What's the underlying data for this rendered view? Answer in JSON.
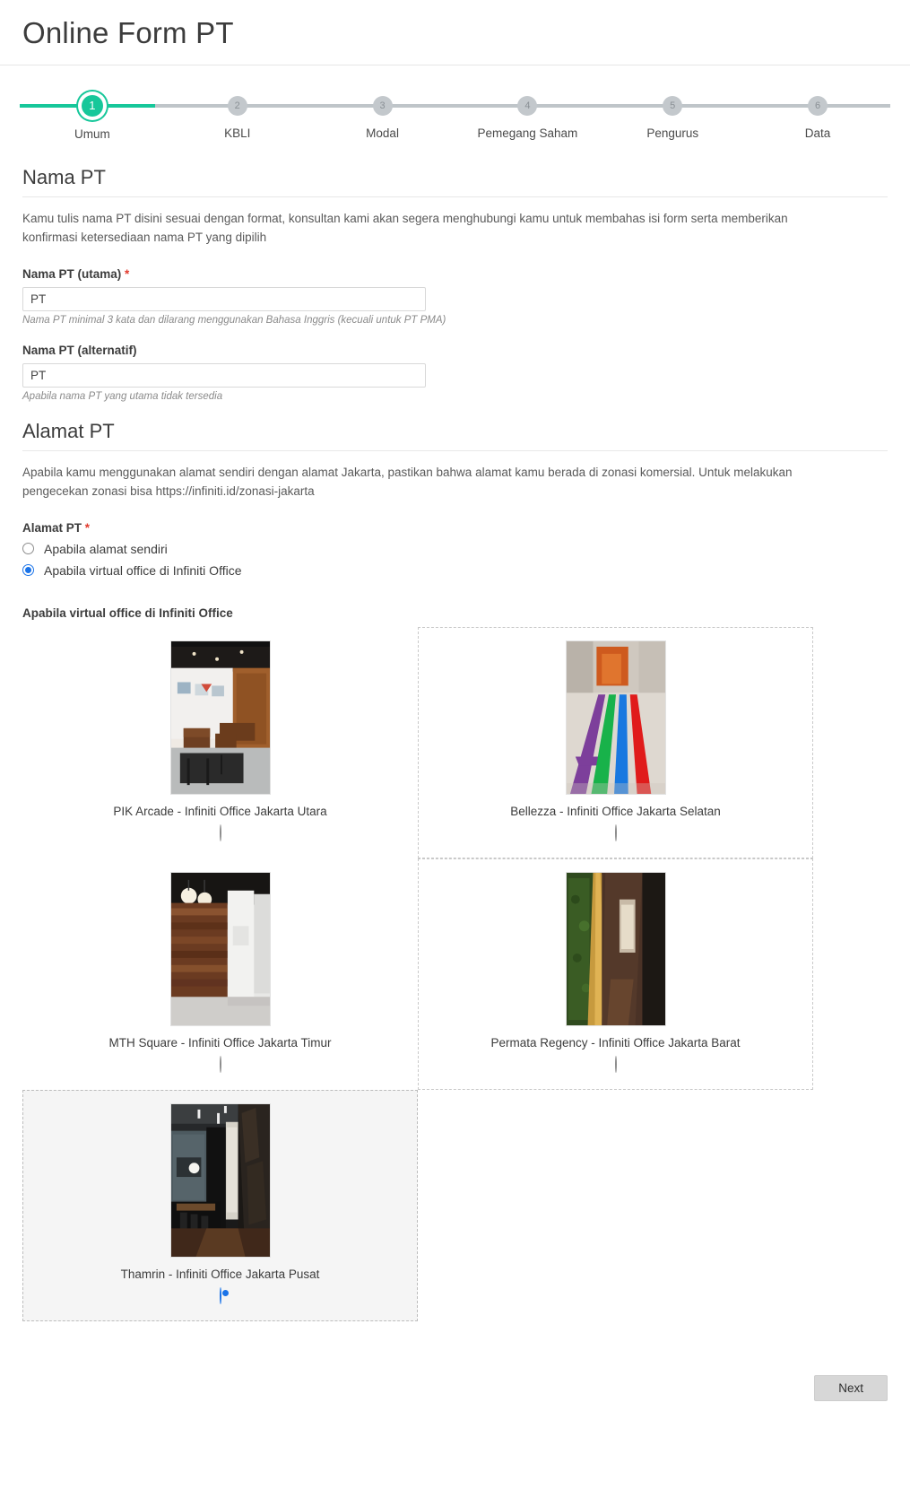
{
  "header": {
    "title": "Online Form PT"
  },
  "stepper": {
    "active_index": 0,
    "active_color": "#16c79a",
    "inactive_color": "#c3c8cc",
    "steps": [
      {
        "number": "1",
        "label": "Umum"
      },
      {
        "number": "2",
        "label": "KBLI"
      },
      {
        "number": "3",
        "label": "Modal"
      },
      {
        "number": "4",
        "label": "Pemegang Saham"
      },
      {
        "number": "5",
        "label": "Pengurus"
      },
      {
        "number": "6",
        "label": "Data"
      }
    ]
  },
  "nama_pt": {
    "heading": "Nama PT",
    "description": "Kamu tulis nama PT disini sesuai dengan format, konsultan kami akan segera menghubungi kamu untuk membahas isi form serta memberikan konfirmasi ketersediaan nama PT yang dipilih",
    "utama": {
      "label": "Nama PT (utama)",
      "required_mark": "*",
      "value": "PT",
      "placeholder": "PT",
      "hint": "Nama PT minimal 3 kata dan dilarang menggunakan Bahasa Inggris (kecuali untuk PT PMA)"
    },
    "alternatif": {
      "label": "Nama PT (alternatif)",
      "value": "PT",
      "placeholder": "PT",
      "hint": "Apabila nama PT yang utama tidak tersedia"
    }
  },
  "alamat_pt": {
    "heading": "Alamat PT",
    "description": "Apabila kamu menggunakan alamat sendiri dengan alamat Jakarta, pastikan bahwa alamat kamu berada di zonasi komersial. Untuk melakukan pengecekan zonasi bisa https://infiniti.id/zonasi-jakarta",
    "field_label": "Alamat PT",
    "required_mark": "*",
    "selected_color": "#1a73e8",
    "options": [
      {
        "label": "Apabila alamat sendiri",
        "checked": false
      },
      {
        "label": "Apabila virtual office di Infiniti Office",
        "checked": true
      }
    ],
    "virtual_office_group_label": "Apabila virtual office di Infiniti Office",
    "offices": [
      {
        "caption": "PIK Arcade - Infiniti Office Jakarta Utara",
        "checked": false,
        "style": "plain",
        "photo": "lobby-seating"
      },
      {
        "caption": "Bellezza - Infiniti Office Jakarta Selatan",
        "checked": false,
        "style": "dashed",
        "photo": "striped-corridor"
      },
      {
        "caption": "MTH Square - Infiniti Office Jakarta Timur",
        "checked": false,
        "style": "plain",
        "photo": "wood-wall-hallway"
      },
      {
        "caption": "Permata Regency - Infiniti Office Jakarta Barat",
        "checked": false,
        "style": "dashed",
        "photo": "green-wall-corridor"
      },
      {
        "caption": "Thamrin - Infiniti Office Jakarta Pusat",
        "checked": true,
        "style": "selected",
        "photo": "dark-corridor"
      }
    ]
  },
  "footer": {
    "next_label": "Next"
  }
}
